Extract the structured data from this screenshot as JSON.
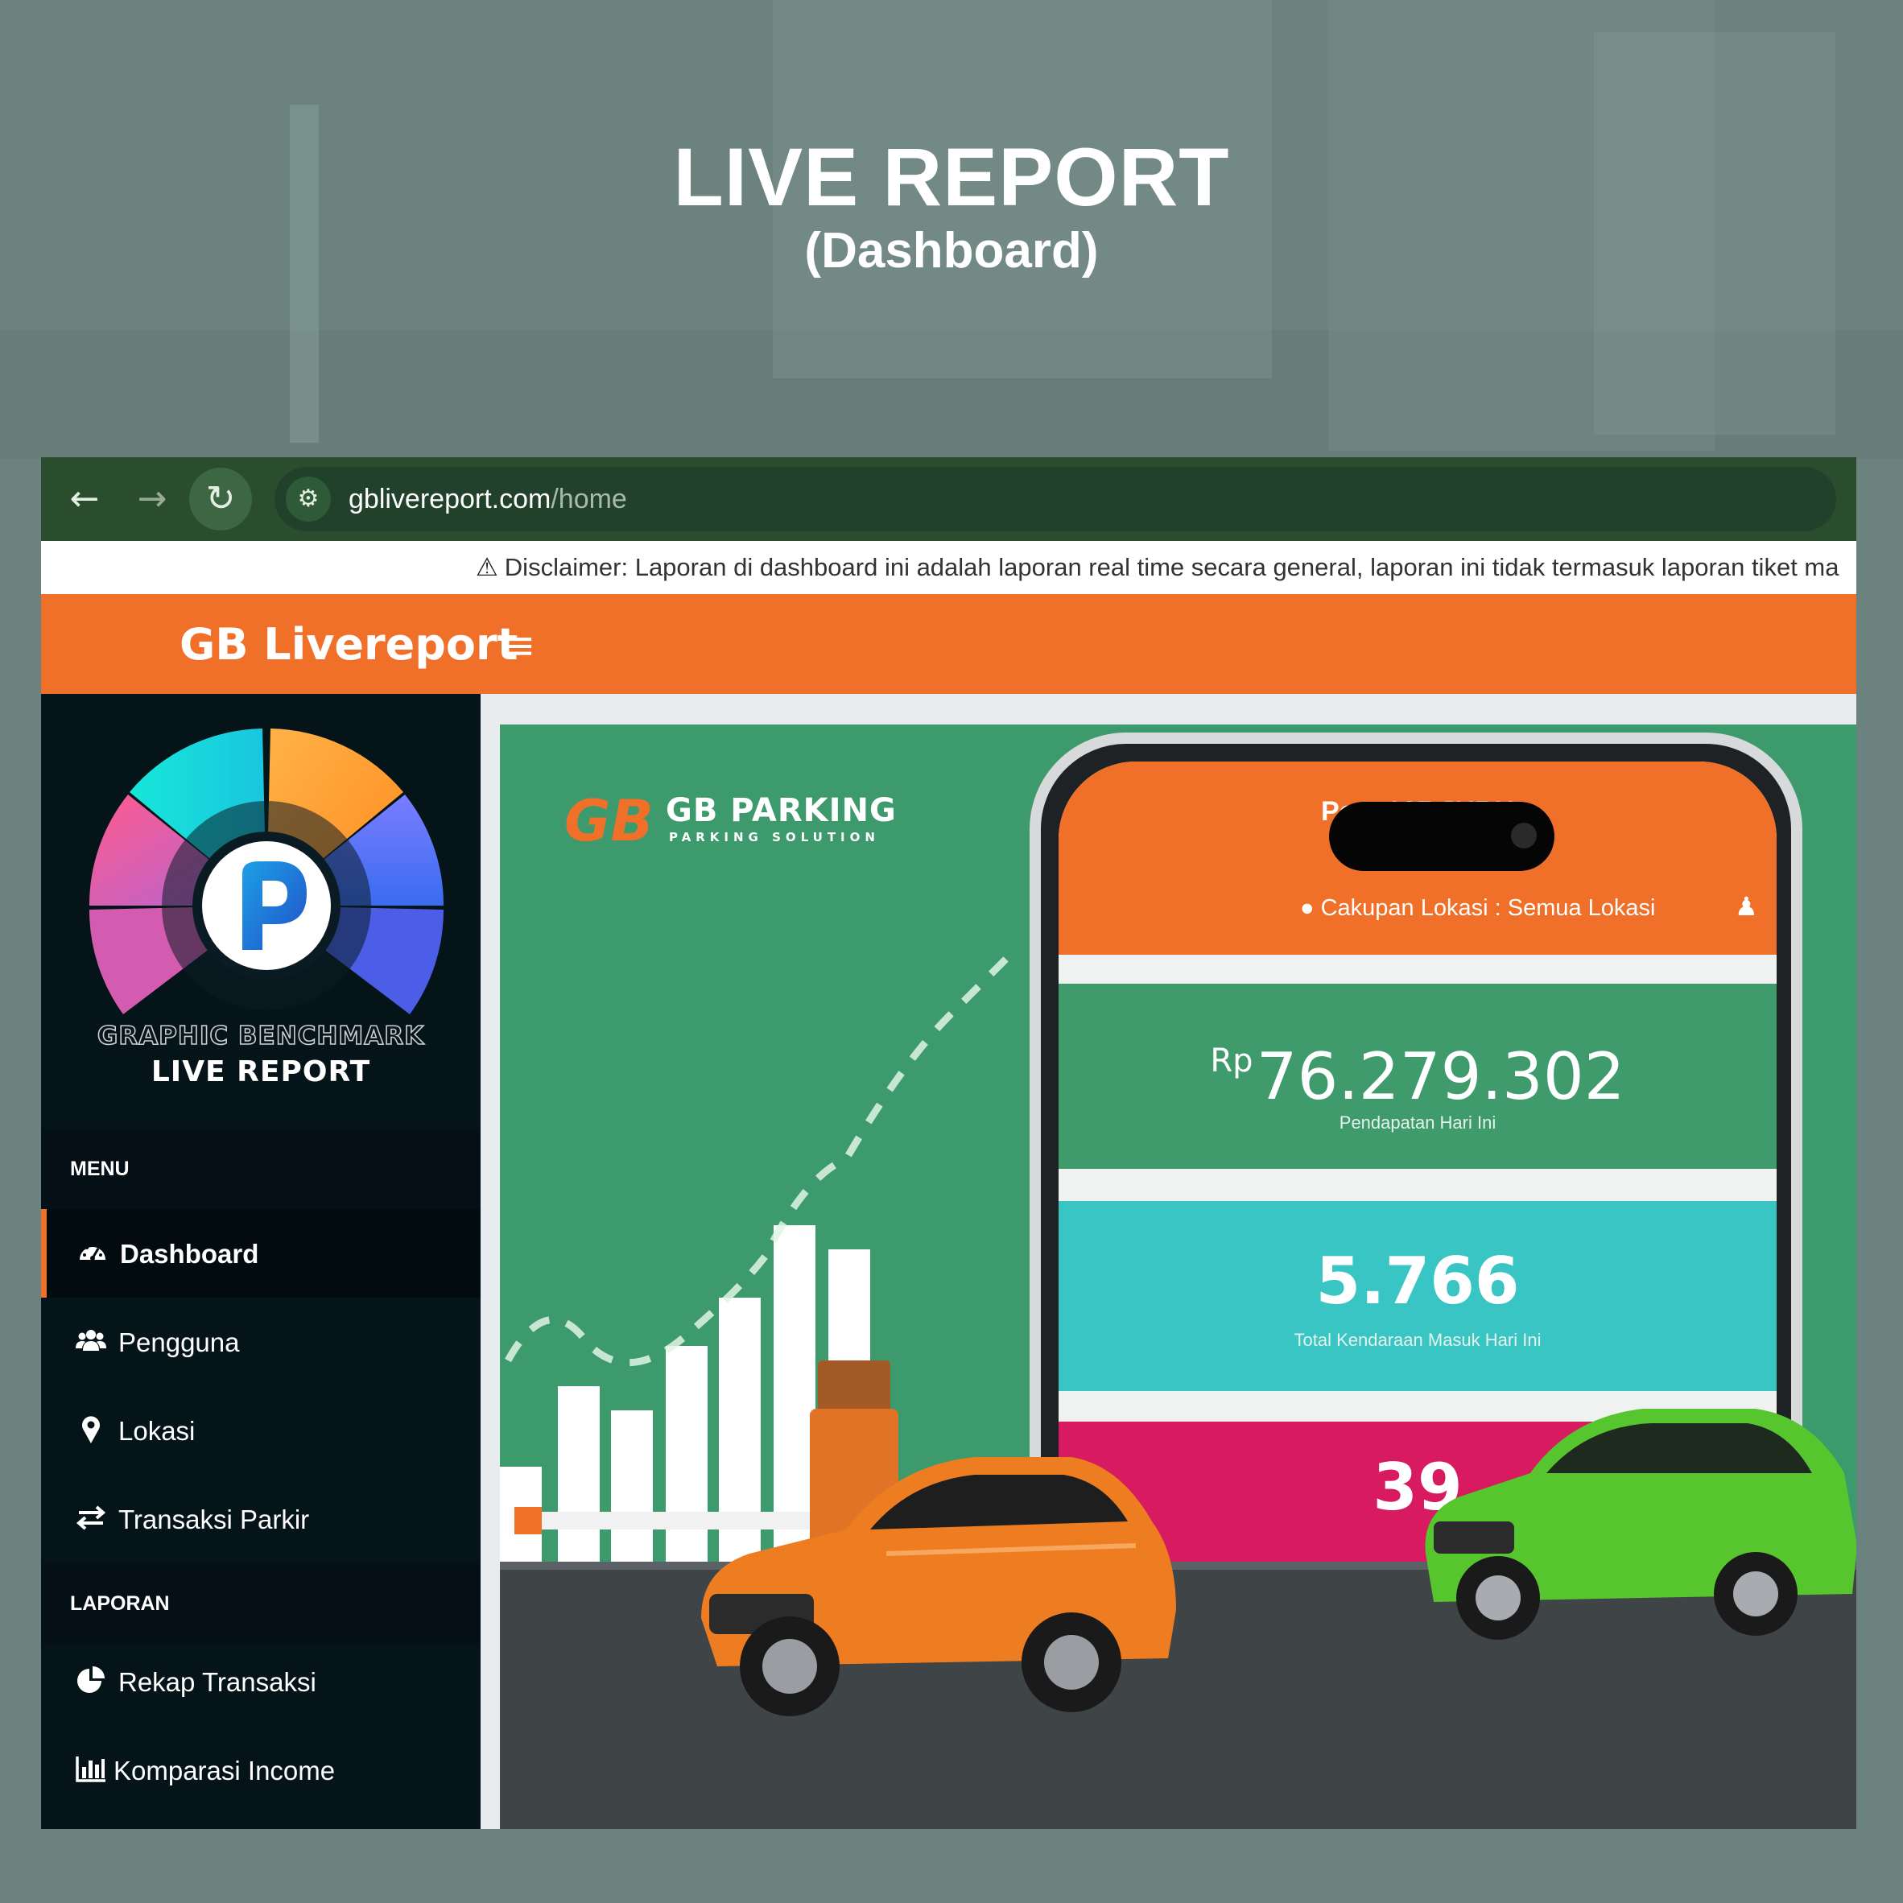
{
  "hero": {
    "title": "LIVE REPORT",
    "subtitle": "(Dashboard)"
  },
  "browser": {
    "url_domain": "gblivereport.com",
    "url_path": "/home",
    "icons": {
      "back": "arrow-left-icon",
      "forward": "arrow-right-icon",
      "reload": "reload-icon",
      "site_info": "tune-icon"
    }
  },
  "disclaimer": "Disclaimer: Laporan di dashboard ini adalah laporan real time secara general, laporan ini tidak termasuk laporan tiket ma",
  "header": {
    "brand": "GB Livereport",
    "menu_toggle_icon": "hamburger-icon",
    "color": "#f07029"
  },
  "sidebar": {
    "logo_line1": "GRAPHIC BENCHMARK",
    "logo_line2": "LIVE REPORT",
    "sections": [
      {
        "heading": "MENU",
        "items": [
          {
            "label": "Dashboard",
            "icon": "speedometer-icon",
            "active": true
          },
          {
            "label": "Pengguna",
            "icon": "users-icon",
            "active": false
          },
          {
            "label": "Lokasi",
            "icon": "map-pin-icon",
            "active": false
          },
          {
            "label": "Transaksi Parkir",
            "icon": "exchange-icon",
            "active": false
          }
        ]
      },
      {
        "heading": "LAPORAN",
        "items": [
          {
            "label": "Rekap Transaksi",
            "icon": "pie-chart-icon",
            "active": false
          },
          {
            "label": "Komparasi Income",
            "icon": "bar-chart-icon",
            "active": false
          }
        ]
      }
    ]
  },
  "promo": {
    "brand_mark": "GB",
    "brand_name": "GB PARKING",
    "brand_tagline": "PARKING SOLUTION",
    "phone": {
      "title": "Po        ...127 JURU",
      "location": "Cakupan Lokasi : Semua Lokasi",
      "revenue_prefix": "Rp",
      "revenue": "76.279.302",
      "revenue_label": "Pendapatan Hari Ini",
      "vehicles": "5.766",
      "vehicles_label": "Total Kendaraan Masuk Hari Ini",
      "third_value": "39"
    }
  }
}
